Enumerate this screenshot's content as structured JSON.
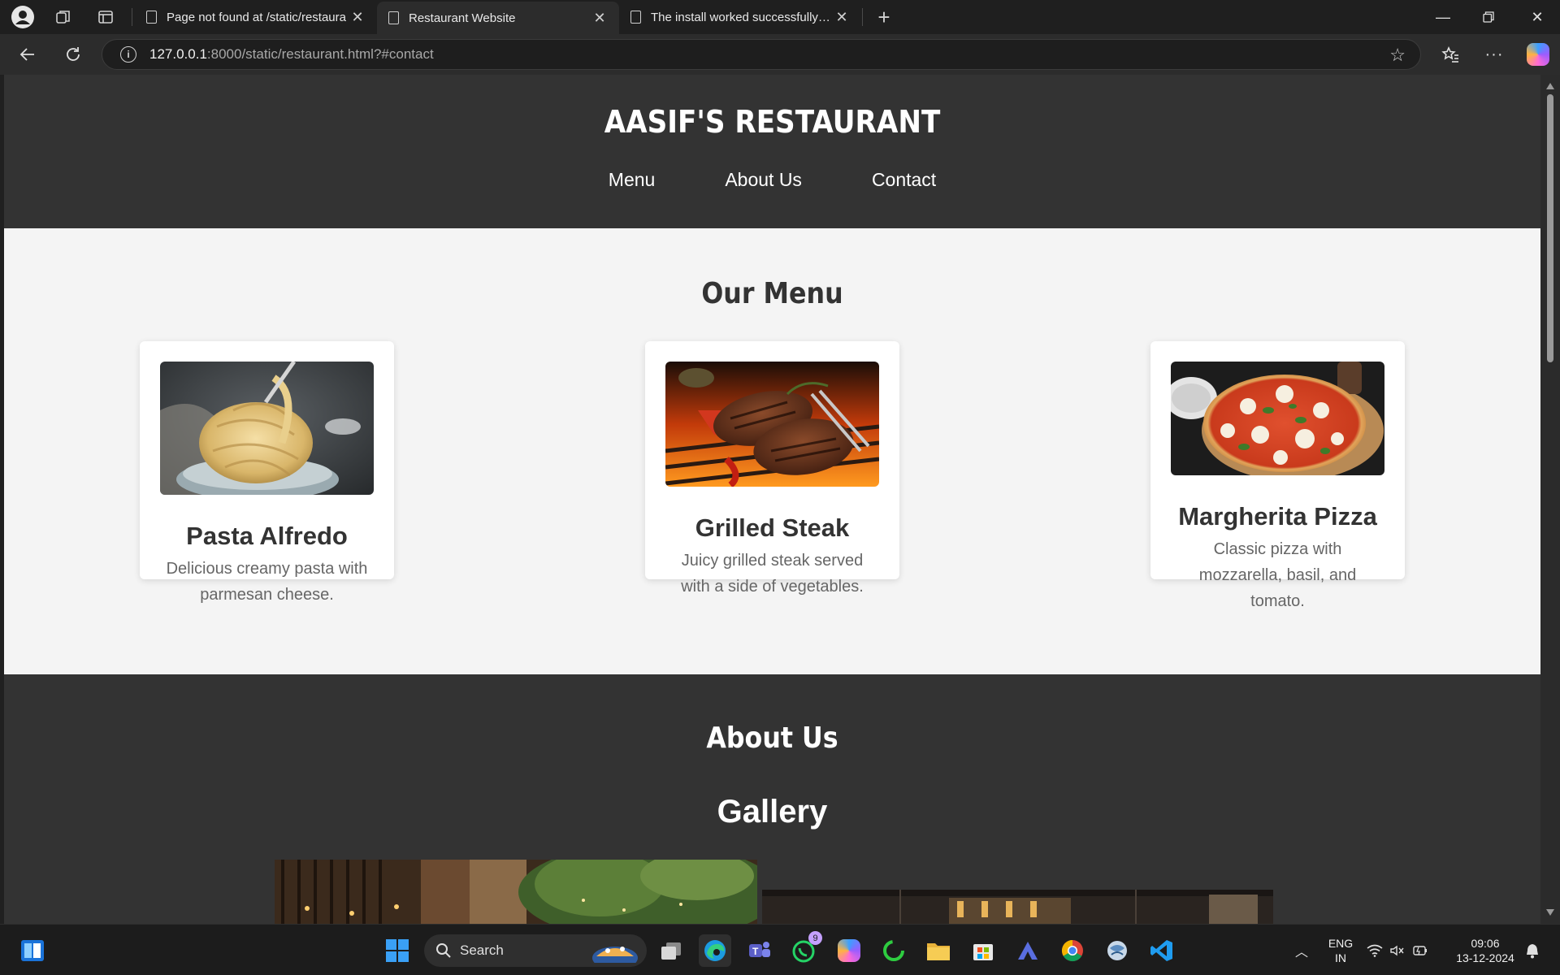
{
  "browser": {
    "tabs": [
      {
        "title": "Page not found at /static/restaura",
        "active": false
      },
      {
        "title": "Restaurant Website",
        "active": true
      },
      {
        "title": "The install worked successfully! Co",
        "active": false
      }
    ],
    "url_host": "127.0.0.1",
    "url_rest": ":8000/static/restaurant.html?#contact"
  },
  "site": {
    "title": "AASIF'S RESTAURANT",
    "nav": [
      "Menu",
      "About Us",
      "Contact"
    ],
    "menu_title": "Our Menu",
    "menu_items": [
      {
        "name": "Pasta Alfredo",
        "desc": "Delicious creamy pasta with parmesan cheese."
      },
      {
        "name": "Grilled Steak",
        "desc": "Juicy grilled steak served with a side of vegetables."
      },
      {
        "name": "Margherita Pizza",
        "desc": "Classic pizza with mozzarella, basil, and tomato."
      }
    ],
    "about_title": "About Us",
    "gallery_title": "Gallery"
  },
  "taskbar": {
    "search_label": "Search",
    "whatsapp_badge": "9",
    "lang_line1": "ENG",
    "lang_line2": "IN",
    "time": "09:06",
    "date": "13-12-2024"
  },
  "colors": {
    "header_bg": "#333333",
    "menu_bg": "#f4f4f4",
    "card_bg": "#ffffff",
    "accent_edge": "#0067c0"
  }
}
